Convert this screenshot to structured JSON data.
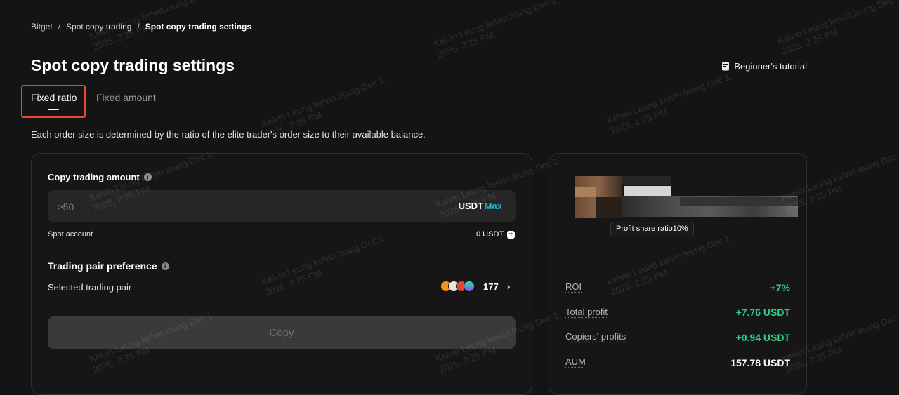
{
  "breadcrumb": {
    "items": [
      "Bitget",
      "Spot copy trading",
      "Spot copy trading settings"
    ],
    "separator": "/"
  },
  "page": {
    "title": "Spot copy trading settings",
    "tutorial_label": "Beginner's tutorial",
    "tutorial_icon": "book-icon"
  },
  "tabs": [
    {
      "label": "Fixed ratio",
      "active": true
    },
    {
      "label": "Fixed amount",
      "active": false
    }
  ],
  "description": "Each order size is determined by the ratio of the elite trader's order size to their available balance.",
  "copy_form": {
    "amount_label": "Copy trading amount",
    "amount_placeholder": "≥50",
    "amount_value": "",
    "currency": "USDT",
    "max_label": "Max",
    "spot_account_label": "Spot account",
    "spot_account_value": "0 USDT",
    "pair_pref_label": "Trading pair preference",
    "selected_pair_label": "Selected trading pair",
    "selected_pair_count": "177",
    "copy_button_label": "Copy"
  },
  "trader": {
    "profit_share": "Profit share ratio10%",
    "stats": [
      {
        "label": "ROI",
        "value": "+7%",
        "color": "#2fcf8a"
      },
      {
        "label": "Total profit",
        "value": "+7.76 USDT",
        "color": "#2fcf8a"
      },
      {
        "label": "Copiers' profits",
        "value": "+0.94 USDT",
        "color": "#2fcf8a"
      },
      {
        "label": "AUM",
        "value": "157.78 USDT",
        "color": "#ffffff"
      }
    ]
  },
  "watermark": {
    "line1": "Kelvin Leung kelvin.leung Dec 1,",
    "line2": "2025, 2:25 PM"
  },
  "colors": {
    "accent": "#1fb6c4",
    "positive": "#2fcf8a",
    "highlight": "#e5473a",
    "background": "#141414"
  }
}
